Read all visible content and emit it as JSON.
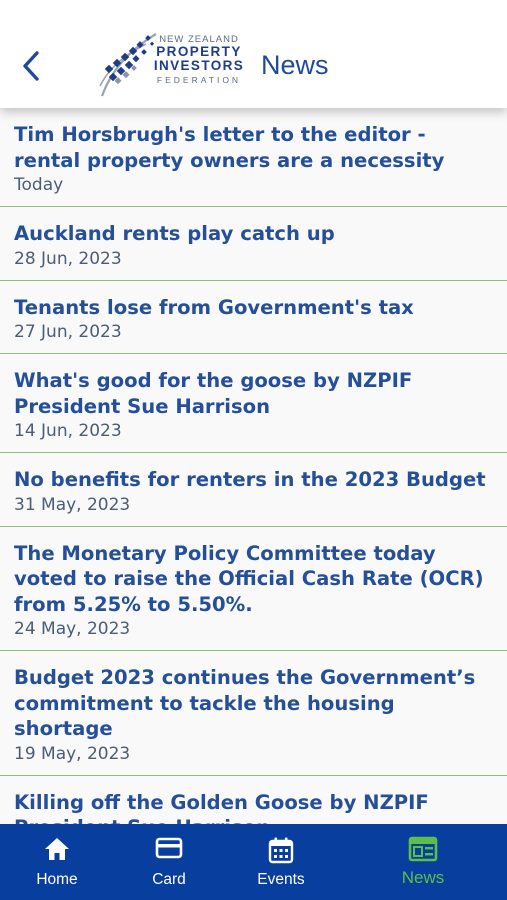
{
  "header": {
    "title": "News",
    "logo": {
      "line1": "NEW ZEALAND",
      "line2": "PROPERTY",
      "line3": "INVESTORS",
      "line4": "FEDERATION"
    }
  },
  "news": [
    {
      "title": "Tim Horsbrugh's letter to the editor - rental property owners are a necessity",
      "date": "Today"
    },
    {
      "title": "Auckland rents play catch up",
      "date": "28 Jun, 2023"
    },
    {
      "title": "Tenants lose from Government's tax",
      "date": "27 Jun, 2023"
    },
    {
      "title": "What's good for the goose by NZPIF President Sue Harrison",
      "date": "14 Jun, 2023"
    },
    {
      "title": "No benefits for renters in the 2023 Budget",
      "date": "31 May, 2023"
    },
    {
      "title": "The Monetary Policy Committee today voted to raise the Official Cash Rate (OCR) from 5.25% to 5.50%.",
      "date": "24 May, 2023"
    },
    {
      "title": "Budget 2023 continues the Government’s commitment to tackle the housing shortage",
      "date": "19 May, 2023"
    },
    {
      "title": "Killing off the Golden Goose by NZPIF President Sue Harrison",
      "date": ""
    }
  ],
  "tabs": [
    {
      "label": "Home",
      "icon": "home-icon"
    },
    {
      "label": "Card",
      "icon": "card-icon"
    },
    {
      "label": "Events",
      "icon": "calendar-icon"
    },
    {
      "label": "News",
      "icon": "news-icon",
      "active": true
    }
  ],
  "colors": {
    "primary": "#083e9e",
    "title_text": "#254f99",
    "accent_green": "#5dbf4a",
    "divider": "#8fbf79"
  }
}
